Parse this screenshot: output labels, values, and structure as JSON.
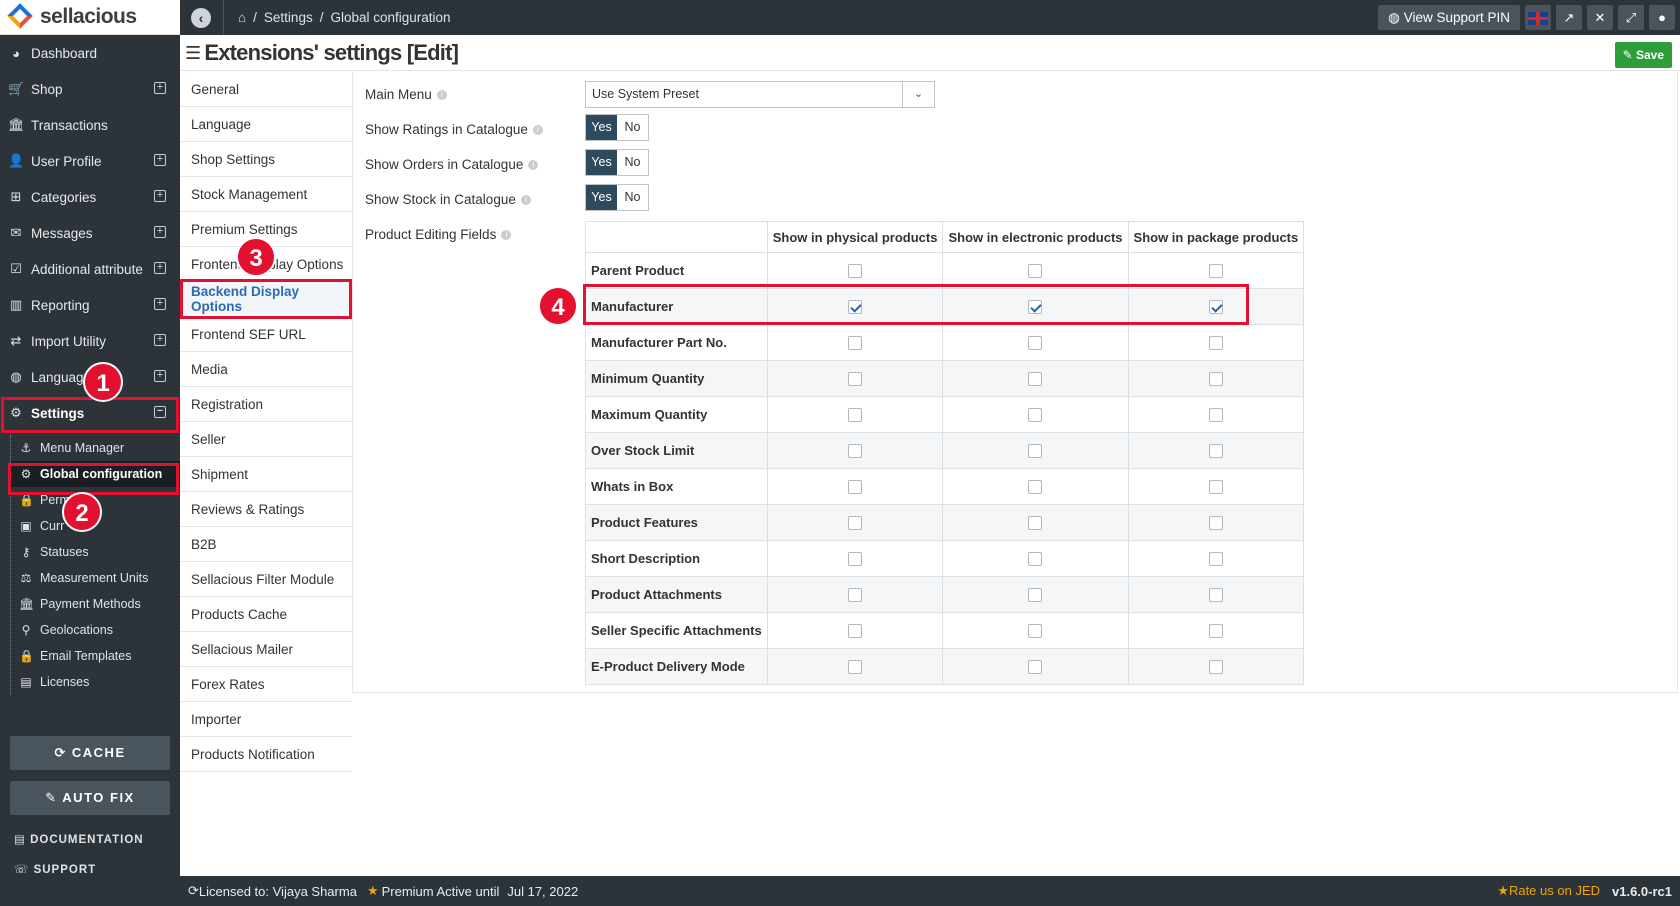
{
  "brand": {
    "name": "sellacious"
  },
  "sidebar": {
    "items": [
      {
        "label": "Dashboard",
        "icon": "dashboard-icon",
        "glyph": "◕"
      },
      {
        "label": "Shop",
        "icon": "shop-icon",
        "glyph": "🛒"
      },
      {
        "label": "Transactions",
        "icon": "bank-icon",
        "glyph": "🏛"
      },
      {
        "label": "User Profile",
        "icon": "user-icon",
        "glyph": "👤"
      },
      {
        "label": "Categories",
        "icon": "sitemap-icon",
        "glyph": "⊞"
      },
      {
        "label": "Messages",
        "icon": "envelope-icon",
        "glyph": "✉"
      },
      {
        "label": "Additional attribute",
        "icon": "checkbox-icon",
        "glyph": "☑"
      },
      {
        "label": "Reporting",
        "icon": "bar-chart-icon",
        "glyph": "▥"
      },
      {
        "label": "Import Utility",
        "icon": "exchange-icon",
        "glyph": "⇄"
      },
      {
        "label": "Language",
        "icon": "globe-icon",
        "glyph": "◍"
      },
      {
        "label": "Settings",
        "icon": "gear-icon",
        "glyph": "⚙"
      }
    ],
    "submenu": [
      {
        "label": "Menu Manager",
        "icon": "anchor-icon",
        "glyph": "⚓"
      },
      {
        "label": "Global configuration",
        "icon": "cogs-icon",
        "glyph": "⚙"
      },
      {
        "label": "Perm",
        "icon": "lock-icon",
        "glyph": "🔒"
      },
      {
        "label": "Curr",
        "icon": "money-icon",
        "glyph": "▣"
      },
      {
        "label": "Statuses",
        "icon": "key-icon",
        "glyph": "⚷"
      },
      {
        "label": "Measurement Units",
        "icon": "balance-icon",
        "glyph": "⚖"
      },
      {
        "label": "Payment Methods",
        "icon": "bank-icon",
        "glyph": "🏛"
      },
      {
        "label": "Geolocations",
        "icon": "map-marker-icon",
        "glyph": "⚲"
      },
      {
        "label": "Email Templates",
        "icon": "lock-icon",
        "glyph": "🔒"
      },
      {
        "label": "Licenses",
        "icon": "file-icon",
        "glyph": "▤"
      }
    ],
    "cache_label": "CACHE",
    "autofix_label": "AUTO FIX",
    "documentation_label": "DOCUMENTATION",
    "support_label": "SUPPORT"
  },
  "topbar": {
    "breadcrumb": [
      "Settings",
      "/",
      "Global configuration"
    ],
    "support_pin_label": "View Support PIN"
  },
  "page": {
    "title": "Extensions' settings [Edit]",
    "save_label": "Save"
  },
  "tabs": [
    "General",
    "Language",
    "Shop Settings",
    "Stock Management",
    "Premium Settings",
    "Frontend Display Options",
    "Backend Display Options",
    "Frontend SEF URL",
    "Media",
    "Registration",
    "Seller",
    "Shipment",
    "Reviews & Ratings",
    "B2B",
    "Sellacious Filter Module",
    "Products Cache",
    "Sellacious Mailer",
    "Forex Rates",
    "Importer",
    "Products Notification"
  ],
  "form": {
    "main_menu_label": "Main Menu",
    "main_menu_value": "Use System Preset",
    "show_ratings_label": "Show Ratings in Catalogue",
    "show_orders_label": "Show Orders in Catalogue",
    "show_stock_label": "Show Stock in Catalogue",
    "editing_fields_label": "Product Editing Fields",
    "yes": "Yes",
    "no": "No"
  },
  "table": {
    "columns": [
      "Show in physical products",
      "Show in electronic products",
      "Show in package products"
    ],
    "rows": [
      {
        "label": "Parent Product",
        "checked": [
          false,
          false,
          false
        ]
      },
      {
        "label": "Manufacturer",
        "checked": [
          true,
          true,
          true
        ]
      },
      {
        "label": "Manufacturer Part No.",
        "checked": [
          false,
          false,
          false
        ]
      },
      {
        "label": "Minimum Quantity",
        "checked": [
          false,
          false,
          false
        ]
      },
      {
        "label": "Maximum Quantity",
        "checked": [
          false,
          false,
          false
        ]
      },
      {
        "label": "Over Stock Limit",
        "checked": [
          false,
          false,
          false
        ]
      },
      {
        "label": "Whats in Box",
        "checked": [
          false,
          false,
          false
        ]
      },
      {
        "label": "Product Features",
        "checked": [
          false,
          false,
          false
        ]
      },
      {
        "label": "Short Description",
        "checked": [
          false,
          false,
          false
        ]
      },
      {
        "label": "Product Attachments",
        "checked": [
          false,
          false,
          false
        ]
      },
      {
        "label": "Seller Specific Attachments",
        "checked": [
          false,
          false,
          false
        ]
      },
      {
        "label": "E-Product Delivery Mode",
        "checked": [
          false,
          false,
          false
        ]
      }
    ]
  },
  "annotations": [
    "1",
    "2",
    "3",
    "4"
  ],
  "footer": {
    "licensed": "Licensed to: Vijaya Sharma",
    "premium": "Premium Active until",
    "premium_date": "Jul 17, 2022",
    "rate": "Rate us on JED",
    "version": "v1.6.0-rc1"
  }
}
